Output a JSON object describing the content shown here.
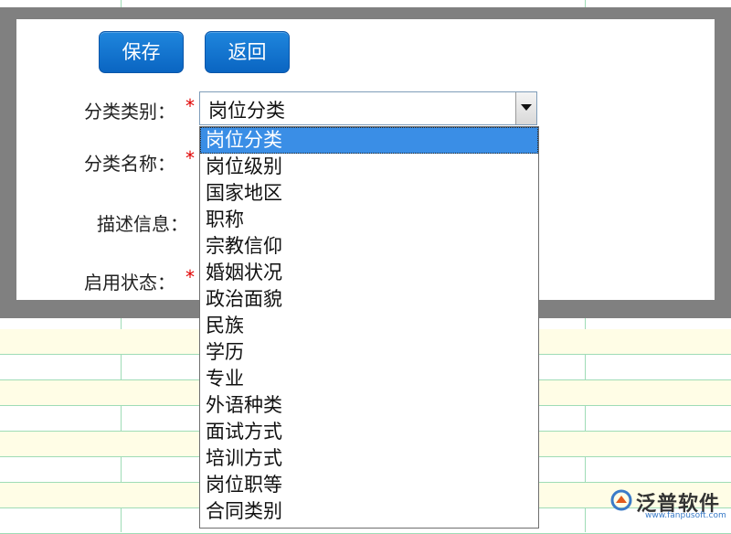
{
  "form": {
    "save_label": "保存",
    "back_label": "返回",
    "category_type_label": "分类类别：",
    "category_name_label": "分类名称：",
    "description_label": "描述信息：",
    "status_label": "启用状态：",
    "required_mark": "*",
    "category_type_value": "岗位分类"
  },
  "dropdown": {
    "options": [
      "岗位分类",
      "岗位级别",
      "国家地区",
      "职称",
      "宗教信仰",
      "婚姻状况",
      "政治面貌",
      "民族",
      "学历",
      "专业",
      "外语种类",
      "面试方式",
      "培训方式",
      "岗位职等",
      "合同类别"
    ],
    "selected_index": 0
  },
  "logo": {
    "name": "泛普软件",
    "url": "www.fanpusoft.com"
  }
}
